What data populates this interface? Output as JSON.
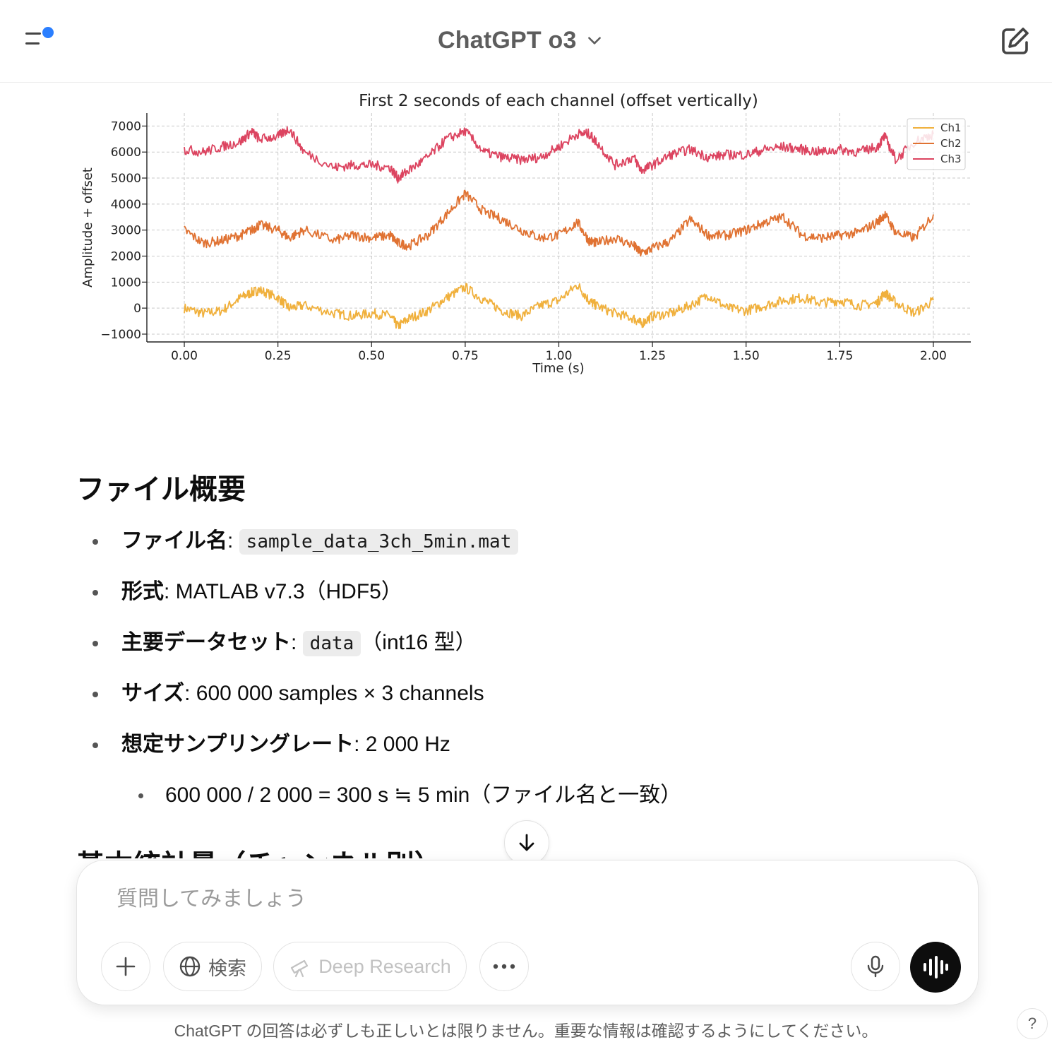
{
  "header": {
    "title": "ChatGPT o3"
  },
  "chart_data": {
    "type": "line",
    "title": "First 2 seconds of each channel (offset vertically)",
    "xlabel": "Time (s)",
    "ylabel": "Amplitude + offset",
    "xlim": [
      -0.1,
      2.1
    ],
    "ylim": [
      -1300,
      7500
    ],
    "xticks": [
      "0.00",
      "0.25",
      "0.50",
      "0.75",
      "1.00",
      "1.25",
      "1.50",
      "1.75",
      "2.00"
    ],
    "yticks": [
      "−1000",
      "0",
      "1000",
      "2000",
      "3000",
      "4000",
      "5000",
      "6000",
      "7000"
    ],
    "grid": true,
    "legend_position": "top-right",
    "x": [
      0,
      0.05,
      0.1,
      0.15,
      0.18,
      0.2,
      0.25,
      0.28,
      0.32,
      0.4,
      0.45,
      0.5,
      0.55,
      0.57,
      0.6,
      0.65,
      0.7,
      0.75,
      0.8,
      0.85,
      0.9,
      0.95,
      1.0,
      1.05,
      1.08,
      1.1,
      1.15,
      1.2,
      1.22,
      1.25,
      1.3,
      1.35,
      1.4,
      1.45,
      1.5,
      1.55,
      1.6,
      1.65,
      1.7,
      1.75,
      1.8,
      1.85,
      1.87,
      1.9,
      1.95,
      2.0
    ],
    "series": [
      {
        "name": "Ch1",
        "color": "#f0b03c",
        "values": [
          0,
          -200,
          -100,
          400,
          600,
          700,
          400,
          0,
          100,
          -200,
          -300,
          -200,
          -300,
          -700,
          -400,
          -100,
          400,
          800,
          300,
          -100,
          -300,
          100,
          300,
          900,
          300,
          100,
          -200,
          -400,
          -600,
          -300,
          -200,
          100,
          500,
          0,
          -100,
          100,
          300,
          400,
          200,
          300,
          100,
          200,
          600,
          200,
          -200,
          300
        ]
      },
      {
        "name": "Ch2",
        "color": "#e07232",
        "values": [
          3000,
          2500,
          2600,
          2800,
          3000,
          3200,
          3000,
          2700,
          3000,
          2600,
          2800,
          2700,
          2800,
          2500,
          2400,
          2800,
          3600,
          4400,
          3700,
          3400,
          3000,
          2700,
          2800,
          3300,
          2600,
          2500,
          2700,
          2400,
          2100,
          2300,
          2600,
          3400,
          2800,
          2800,
          3000,
          3300,
          3500,
          2800,
          2700,
          2800,
          2900,
          3300,
          3600,
          2900,
          2700,
          3600
        ]
      },
      {
        "name": "Ch3",
        "color": "#dc4460",
        "values": [
          6100,
          6000,
          6200,
          6400,
          6800,
          6500,
          6600,
          6900,
          6000,
          5400,
          5500,
          5500,
          5400,
          5000,
          5300,
          5800,
          6500,
          6800,
          6000,
          5800,
          5700,
          5800,
          6200,
          6700,
          6700,
          6400,
          5500,
          5800,
          5300,
          5500,
          5900,
          6100,
          5800,
          5900,
          5900,
          6100,
          6200,
          6100,
          6000,
          6100,
          6000,
          6200,
          6600,
          5700,
          6400,
          6700
        ]
      }
    ]
  },
  "section": {
    "title": "ファイル概要",
    "next_title": "基本統計量（チャンネル別）"
  },
  "items": {
    "filename": {
      "key": "ファイル名",
      "sep": ": ",
      "code": "sample_data_3ch_5min.mat"
    },
    "format": {
      "key": "形式",
      "value": ": MATLAB v7.3（HDF5）"
    },
    "dataset": {
      "key": "主要データセット",
      "sep": ": ",
      "code": "data",
      "after": "（int16 型）"
    },
    "size": {
      "key": "サイズ",
      "value": ": 600 000 samples × 3 channels"
    },
    "rate": {
      "key": "想定サンプリングレート",
      "value": ": 2 000 Hz"
    },
    "rate_sub": "600 000 / 2 000 = 300 s ≒ 5 min（ファイル名と一致）"
  },
  "composer": {
    "placeholder": "質問してみましょう",
    "search_label": "検索",
    "deep_research_label": "Deep Research"
  },
  "footer": {
    "disclaimer": "ChatGPT の回答は必ずしも正しいとは限りません。重要な情報は確認するようにしてください。",
    "help": "?"
  }
}
